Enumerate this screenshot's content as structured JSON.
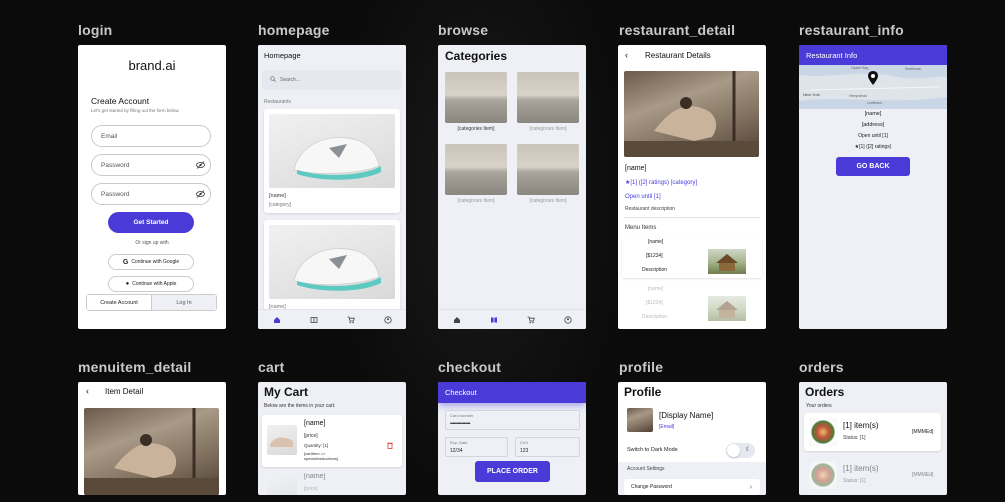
{
  "screens": {
    "login": "login",
    "homepage": "homepage",
    "browse": "browse",
    "restaurant_detail": "restaurant_detail",
    "restaurant_info": "restaurant_info",
    "menuitem_detail": "menuitem_detail",
    "cart": "cart",
    "checkout": "checkout",
    "profile": "profile",
    "orders": "orders"
  },
  "login": {
    "brand": "brand.ai",
    "title": "Create Account",
    "subtitle": "Let's get started by filling out the form below.",
    "email_placeholder": "Email",
    "password_placeholder": "Password",
    "confirm_placeholder": "Password",
    "get_started": "Get Started",
    "or_sign_up": "Or sign up with",
    "google": "Continue with Google",
    "apple": "Continue with Apple",
    "tab_create": "Create Account",
    "tab_login": "Log In"
  },
  "homepage": {
    "title": "Homepage",
    "search_placeholder": "Search...",
    "section": "Restaurants",
    "card_name": "[name]",
    "card_category": "[category]",
    "card2_name": "[name]"
  },
  "browse": {
    "title": "Categories",
    "items": [
      "[categories Item]",
      "[categories Item]",
      "[categories Item]",
      "[categories Item]"
    ]
  },
  "restaurant_detail": {
    "title": "Restaurant Details",
    "name": "[name]",
    "rating": "★[1] ([2] ratings)",
    "category": "[category]",
    "open": "Open until [1]",
    "description": "Restaurant description",
    "menu_items": "Menu Items",
    "item_name": "[name]",
    "item_price": "[$1234]",
    "item_desc": "Description",
    "item2_name": "[name]",
    "item2_price": "[$1234]",
    "item2_desc": "Description"
  },
  "restaurant_info": {
    "title": "Restaurant Info",
    "map_labels": [
      "Oyster Bay",
      "New York",
      "Hempstead",
      "Levittown",
      "Smithtown"
    ],
    "name": "[name]",
    "address": "[address]",
    "open": "Open until [1]",
    "rating": "★[1] ([2] ratings)",
    "go_back": "GO BACK"
  },
  "menuitem_detail": {
    "title": "Item Detail"
  },
  "cart": {
    "title": "My Cart",
    "subtitle": "Below are the items in your cart.",
    "item_name": "[name]",
    "item_price": "[price]",
    "item_qty": "Quantity: [1]",
    "item_instr": "[cartItem => specialInstructions]",
    "item2_name": "[name]",
    "item2_price": "[price]"
  },
  "checkout": {
    "title": "Checkout",
    "card_label": "Card number",
    "card_value": "••••••••••••••••",
    "exp_label": "Exp. Date",
    "exp_value": "12/34",
    "cvv_label": "CVV",
    "cvv_value": "123",
    "place_order": "PLACE ORDER"
  },
  "profile": {
    "title": "Profile",
    "display_name": "[Display Name]",
    "email": "[Email]",
    "dark_mode": "Switch to Dark Mode",
    "account_settings": "Account Settings",
    "change_password": "Change Password"
  },
  "orders": {
    "title": "Orders",
    "subtitle": "Your orders",
    "item1_count": "[1] item(s)",
    "item1_status": "Status: [1]",
    "item1_date": "[MMMEd]",
    "item2_count": "[1] item(s)",
    "item2_status": "Status: [1]",
    "item2_date": "[MMMEd]"
  },
  "colors": {
    "accent": "#4a3bd8",
    "background": "#0b0b0b",
    "screen_bg": "#eef0f5"
  }
}
